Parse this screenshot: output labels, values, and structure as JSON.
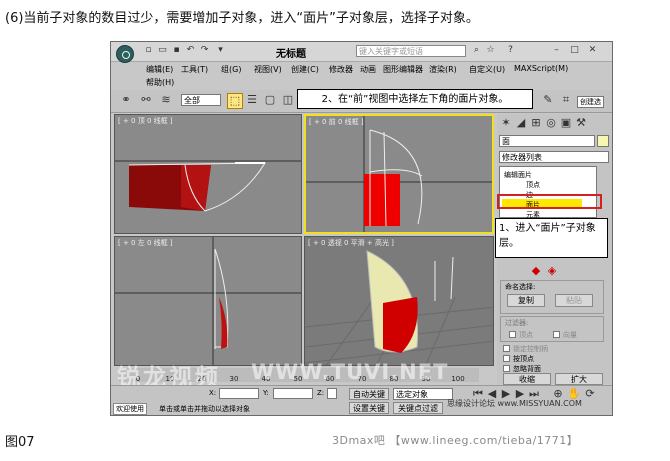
{
  "caption": "(6)当前子对象的数目过少，需要增加子对象，进入“面片”子对象层，选择子对象。",
  "figure_label": "图07",
  "footer": "3Dmax吧 【www.lineeg.com/tieba/1771】",
  "window": {
    "title": "无标题",
    "search_placeholder": "键入关键字或短语"
  },
  "menu": [
    "编辑(E)",
    "工具(T)",
    "组(G)",
    "视图(V)",
    "创建(C)",
    "修改器",
    "动画",
    "图形编辑器",
    "渲染(R)",
    "自定义(U)",
    "MAXScript(M)"
  ],
  "help_label": "帮助(H)",
  "toolbar": {
    "filter_value": "全部",
    "create_sel_label": "创建选"
  },
  "callout_step2": "2、在“前”视图中选择左下角的面片对象。",
  "callout_step1": "1、进入“面片”子对象层。",
  "viewports": {
    "top": "[ + 0 顶 0 线框 ]",
    "front": "[ + 0 前 0 线框 ]",
    "left": "[ + 0 左 0 线框 ]",
    "persp": "[ + 0 透视 0 平滑 + 高光 ]"
  },
  "command_panel": {
    "object_name": "面",
    "modifier_list": "修改器列表",
    "stack": {
      "root": "编辑面片",
      "items": [
        "顶点",
        "边",
        "面片",
        "元素"
      ],
      "selected_index": 2
    },
    "named_selection_title": "命名选择:",
    "copy_btn": "复制",
    "paste_btn": "粘贴",
    "filter_title": "过滤器:",
    "filter_vertex": "顶点",
    "filter_vector": "向量",
    "lock_handles": "锁定控制柄",
    "by_vertex": "按顶点",
    "ignore_backfacing": "忽略背面",
    "shrink_btn": "收缩",
    "grow_btn": "扩大"
  },
  "timeline": {
    "ticks": [
      "0",
      "10",
      "20",
      "30",
      "40",
      "50",
      "60",
      "70",
      "80",
      "90",
      "100"
    ]
  },
  "status": {
    "welcome": "欢迎使用",
    "hint": "单击或单击并拖动以选择对象",
    "x_label": "X:",
    "y_label": "Y:",
    "z_label": "Z:",
    "autokey_btn": "自动关键点",
    "setkey_btn": "设置关键点",
    "sel_dropdown": "选定对象",
    "keyfilter_btn": "关键点过滤器...",
    "site": "思缘设计论坛 www.MISSYUAN.COM"
  },
  "watermark": "锐龙视频",
  "watermark_site": "WWW.TUVI.NET"
}
